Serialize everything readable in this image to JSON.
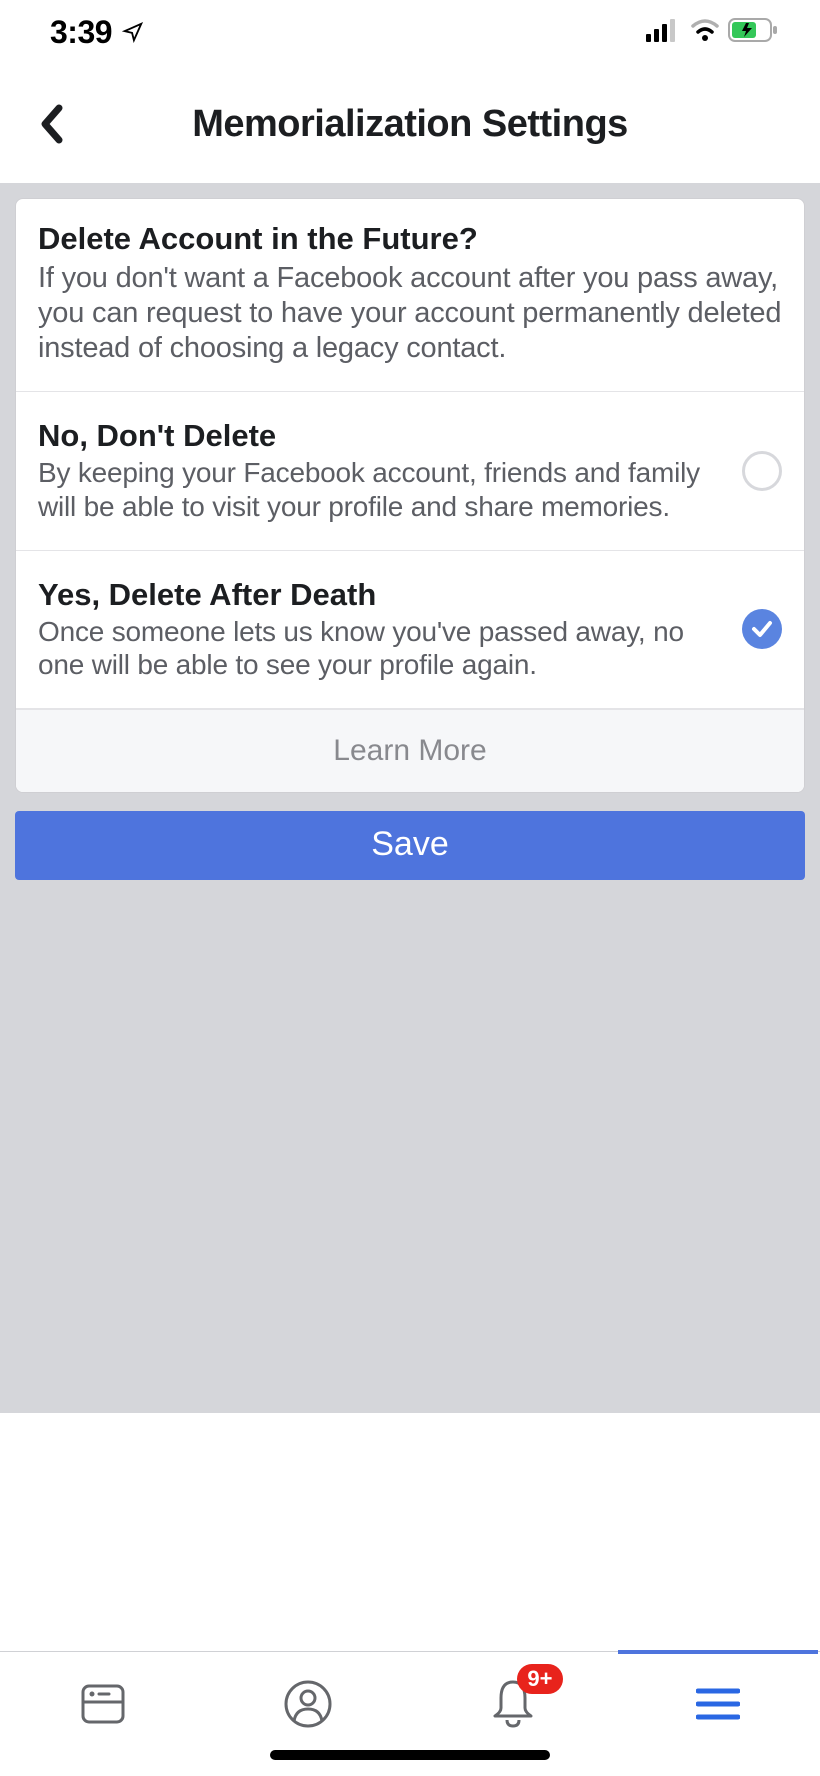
{
  "status_bar": {
    "time": "3:39"
  },
  "header": {
    "title": "Memorialization Settings"
  },
  "delete_section": {
    "heading": "Delete Account in the Future?",
    "description": "If you don't want a Facebook account after you pass away, you can request to have your account permanently deleted instead of choosing a legacy contact."
  },
  "options": [
    {
      "title": "No, Don't Delete",
      "description": "By keeping your Facebook account, friends and family will be able to visit your profile and share memories.",
      "selected": false
    },
    {
      "title": "Yes, Delete After Death",
      "description": "Once someone lets us know you've passed away, no one will be able to see your profile again.",
      "selected": true
    }
  ],
  "learn_more": "Learn More",
  "save_button": "Save",
  "bottom_nav": {
    "notification_badge": "9+"
  }
}
